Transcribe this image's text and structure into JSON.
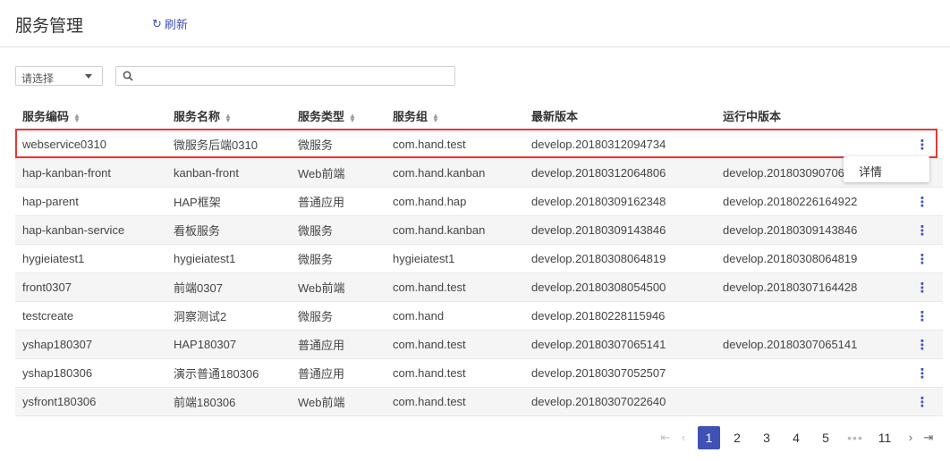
{
  "header": {
    "title": "服务管理",
    "refresh_label": "刷新"
  },
  "filter": {
    "select_placeholder": "请选择",
    "search_value": ""
  },
  "table": {
    "columns": [
      {
        "label": "服务编码",
        "sortable": true
      },
      {
        "label": "服务名称",
        "sortable": true
      },
      {
        "label": "服务类型",
        "sortable": true
      },
      {
        "label": "服务组",
        "sortable": true
      },
      {
        "label": "最新版本",
        "sortable": false
      },
      {
        "label": "运行中版本",
        "sortable": false
      }
    ],
    "rows": [
      [
        "webservice0310",
        "微服务后端0310",
        "微服务",
        "com.hand.test",
        "develop.20180312094734",
        ""
      ],
      [
        "hap-kanban-front",
        "kanban-front",
        "Web前端",
        "com.hand.kanban",
        "develop.20180312064806",
        "develop.20180309070642"
      ],
      [
        "hap-parent",
        "HAP框架",
        "普通应用",
        "com.hand.hap",
        "develop.20180309162348",
        "develop.20180226164922"
      ],
      [
        "hap-kanban-service",
        "看板服务",
        "微服务",
        "com.hand.kanban",
        "develop.20180309143846",
        "develop.20180309143846"
      ],
      [
        "hygieiatest1",
        "hygieiatest1",
        "微服务",
        "hygieiatest1",
        "develop.20180308064819",
        "develop.20180308064819"
      ],
      [
        "front0307",
        "前端0307",
        "Web前端",
        "com.hand.test",
        "develop.20180308054500",
        "develop.20180307164428"
      ],
      [
        "testcreate",
        "洞察测试2",
        "微服务",
        "com.hand",
        "develop.20180228115946",
        ""
      ],
      [
        "yshap180307",
        "HAP180307",
        "普通应用",
        "com.hand.test",
        "develop.20180307065141",
        "develop.20180307065141"
      ],
      [
        "yshap180306",
        "演示普通180306",
        "普通应用",
        "com.hand.test",
        "develop.20180307052507",
        ""
      ],
      [
        "ysfront180306",
        "前端180306",
        "Web前端",
        "com.hand.test",
        "develop.20180307022640",
        ""
      ]
    ],
    "action_icon": "more-vert-icon",
    "highlight_color": "#e53935"
  },
  "popup": {
    "item_label": "详情"
  },
  "pagination": {
    "first": "⇤",
    "prev": "‹",
    "next": "›",
    "last": "⇥",
    "pages": [
      "1",
      "2",
      "3",
      "4",
      "5"
    ],
    "ellipsis": "•••",
    "last_page": "11",
    "current": "1"
  },
  "colors": {
    "accent": "#3f51b5",
    "highlight": "#e53935"
  }
}
